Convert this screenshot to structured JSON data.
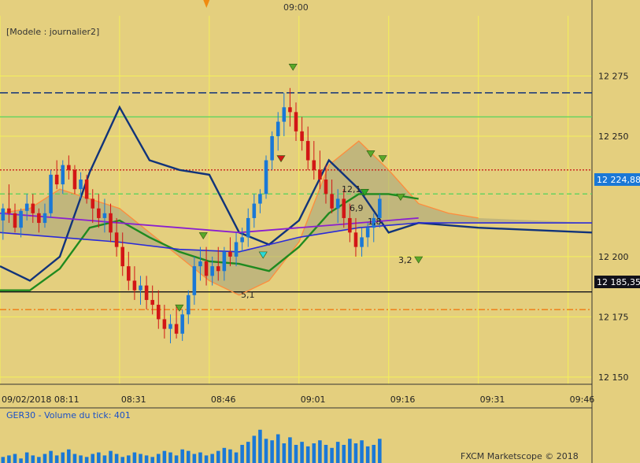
{
  "colors": {
    "background": "#e4cf7e",
    "grid": "#f4f05a",
    "candle_up": "#1a78d6",
    "candle_down": "#d21616",
    "tenkan": "#ff8c3c",
    "kijun": "#11337a",
    "chikou": "#1f8a1f",
    "span_a": "#2a2ad8",
    "ma": "#8a1fd0",
    "volume": "#1a78d6",
    "resistance": "#c81d1d",
    "support": "#f07a10",
    "cloud_fill": "#a4a27a",
    "cloud_fill_bear": "#e9a070"
  },
  "header": {
    "time_marker": "09:00"
  },
  "main_panel": {
    "title": "[Modele : journalier2]"
  },
  "volume_panel": {
    "title": "GER30 - Volume du tick: 401",
    "copyright": "FXCM Marketscope © 2018"
  },
  "price_labels": {
    "current": "12 224,88",
    "level": "12 185,35"
  },
  "annotations": [
    "12,1",
    "6,9",
    "1,8",
    "3,2",
    "5,1"
  ],
  "chart_data": {
    "type": "candlestick",
    "instrument": "GER30",
    "x_tick_labels": [
      "09/02/2018 08:11",
      "08:31",
      "08:46",
      "09:01",
      "09:16",
      "09:31",
      "09:46"
    ],
    "x_tick_minutes": [
      491,
      511,
      526,
      541,
      556,
      571,
      586
    ],
    "y_tick_labels": [
      "12 275",
      "12 250",
      "12 200",
      "12 175",
      "12 150"
    ],
    "y_tick_values": [
      12275,
      12250,
      12200,
      12175,
      12150
    ],
    "ylim": [
      12147,
      12300
    ],
    "xlim_minutes": [
      491,
      590
    ],
    "start_minute": 491,
    "candles": [
      [
        12215,
        12222,
        12207,
        12220
      ],
      [
        12220,
        12230,
        12214,
        12218
      ],
      [
        12218,
        12222,
        12210,
        12212
      ],
      [
        12212,
        12220,
        12208,
        12219
      ],
      [
        12219,
        12226,
        12215,
        12222
      ],
      [
        12222,
        12226,
        12214,
        12218
      ],
      [
        12218,
        12220,
        12210,
        12214
      ],
      [
        12214,
        12222,
        12212,
        12218
      ],
      [
        12218,
        12236,
        12216,
        12234
      ],
      [
        12234,
        12240,
        12228,
        12230
      ],
      [
        12230,
        12240,
        12226,
        12238
      ],
      [
        12238,
        12242,
        12232,
        12236
      ],
      [
        12236,
        12238,
        12226,
        12228
      ],
      [
        12228,
        12235,
        12224,
        12232
      ],
      [
        12232,
        12234,
        12222,
        12224
      ],
      [
        12224,
        12228,
        12214,
        12220
      ],
      [
        12220,
        12226,
        12212,
        12216
      ],
      [
        12216,
        12224,
        12210,
        12218
      ],
      [
        12218,
        12222,
        12206,
        12210
      ],
      [
        12210,
        12216,
        12200,
        12204
      ],
      [
        12204,
        12210,
        12192,
        12196
      ],
      [
        12196,
        12202,
        12186,
        12190
      ],
      [
        12190,
        12196,
        12182,
        12186
      ],
      [
        12186,
        12192,
        12180,
        12188
      ],
      [
        12188,
        12192,
        12178,
        12182
      ],
      [
        12182,
        12188,
        12176,
        12180
      ],
      [
        12180,
        12186,
        12170,
        12174
      ],
      [
        12174,
        12180,
        12166,
        12170
      ],
      [
        12170,
        12176,
        12164,
        12172
      ],
      [
        12172,
        12180,
        12166,
        12168
      ],
      [
        12168,
        12178,
        12165,
        12176
      ],
      [
        12176,
        12186,
        12172,
        12184
      ],
      [
        12184,
        12200,
        12180,
        12196
      ],
      [
        12196,
        12204,
        12190,
        12198
      ],
      [
        12198,
        12204,
        12188,
        12192
      ],
      [
        12192,
        12200,
        12188,
        12196
      ],
      [
        12196,
        12204,
        12190,
        12194
      ],
      [
        12194,
        12204,
        12190,
        12202
      ],
      [
        12202,
        12208,
        12196,
        12200
      ],
      [
        12200,
        12210,
        12196,
        12206
      ],
      [
        12206,
        12212,
        12202,
        12208
      ],
      [
        12208,
        12220,
        12204,
        12216
      ],
      [
        12216,
        12226,
        12212,
        12222
      ],
      [
        12222,
        12228,
        12218,
        12226
      ],
      [
        12226,
        12242,
        12224,
        12240
      ],
      [
        12240,
        12252,
        12236,
        12250
      ],
      [
        12250,
        12260,
        12244,
        12256
      ],
      [
        12256,
        12268,
        12250,
        12262
      ],
      [
        12262,
        12270,
        12254,
        12260
      ],
      [
        12260,
        12264,
        12248,
        12252
      ],
      [
        12252,
        12258,
        12244,
        12248
      ],
      [
        12248,
        12254,
        12236,
        12240
      ],
      [
        12240,
        12248,
        12232,
        12236
      ],
      [
        12236,
        12244,
        12228,
        12232
      ],
      [
        12232,
        12238,
        12222,
        12226
      ],
      [
        12226,
        12232,
        12218,
        12220
      ],
      [
        12220,
        12228,
        12214,
        12224
      ],
      [
        12224,
        12228,
        12212,
        12216
      ],
      [
        12216,
        12222,
        12206,
        12210
      ],
      [
        12210,
        12216,
        12200,
        12204
      ],
      [
        12204,
        12212,
        12200,
        12208
      ],
      [
        12208,
        12214,
        12204,
        12212
      ],
      [
        12212,
        12218,
        12206,
        12216
      ],
      [
        12216,
        12226,
        12212,
        12224
      ]
    ],
    "series": [
      {
        "values": [
          [
            491,
            12218
          ],
          [
            496,
            12220
          ],
          [
            501,
            12228
          ],
          [
            506,
            12224
          ],
          [
            511,
            12220
          ],
          [
            516,
            12210
          ],
          [
            521,
            12200
          ],
          [
            526,
            12190
          ],
          [
            531,
            12184
          ],
          [
            536,
            12190
          ],
          [
            541,
            12206
          ],
          [
            546,
            12238
          ],
          [
            551,
            12248
          ],
          [
            556,
            12236
          ],
          [
            561,
            12222
          ],
          [
            566,
            12218
          ],
          [
            571,
            12216
          ]
        ]
      },
      {
        "values": [
          [
            491,
            12196
          ],
          [
            496,
            12190
          ],
          [
            501,
            12200
          ],
          [
            506,
            12235
          ],
          [
            511,
            12262
          ],
          [
            516,
            12240
          ],
          [
            521,
            12236
          ],
          [
            526,
            12234
          ],
          [
            531,
            12210
          ],
          [
            536,
            12205
          ],
          [
            541,
            12215
          ],
          [
            546,
            12240
          ],
          [
            551,
            12228
          ],
          [
            556,
            12210
          ],
          [
            561,
            12214
          ],
          [
            571,
            12212
          ],
          [
            590,
            12210
          ]
        ]
      },
      {
        "values": [
          [
            491,
            12186
          ],
          [
            496,
            12186
          ],
          [
            501,
            12195
          ],
          [
            506,
            12212
          ],
          [
            511,
            12215
          ],
          [
            516,
            12208
          ],
          [
            521,
            12202
          ],
          [
            526,
            12198
          ],
          [
            531,
            12197
          ],
          [
            536,
            12194
          ],
          [
            541,
            12204
          ],
          [
            546,
            12218
          ],
          [
            551,
            12226
          ],
          [
            556,
            12226
          ],
          [
            561,
            12224
          ]
        ]
      },
      {
        "values": [
          [
            491,
            12210
          ],
          [
            501,
            12208
          ],
          [
            511,
            12206
          ],
          [
            521,
            12203
          ],
          [
            531,
            12202
          ],
          [
            541,
            12208
          ],
          [
            551,
            12212
          ],
          [
            561,
            12214
          ],
          [
            571,
            12214
          ],
          [
            590,
            12214
          ]
        ]
      },
      {
        "values": [
          [
            491,
            12218
          ],
          [
            501,
            12216
          ],
          [
            511,
            12214
          ],
          [
            521,
            12212
          ],
          [
            531,
            12210
          ],
          [
            541,
            12212
          ],
          [
            551,
            12214
          ],
          [
            561,
            12216
          ]
        ]
      }
    ],
    "horizontal_levels": [
      12268,
      12258,
      12236,
      12226,
      12185.35,
      12178
    ],
    "volume": [
      4,
      5,
      6,
      3,
      7,
      5,
      4,
      6,
      8,
      5,
      7,
      9,
      6,
      5,
      4,
      6,
      7,
      5,
      8,
      6,
      4,
      5,
      7,
      6,
      5,
      4,
      6,
      8,
      7,
      5,
      9,
      8,
      6,
      7,
      5,
      6,
      8,
      10,
      9,
      7,
      12,
      14,
      18,
      22,
      16,
      15,
      19,
      13,
      17,
      12,
      14,
      11,
      13,
      15,
      12,
      10,
      14,
      12,
      16,
      13,
      15,
      11,
      12,
      16
    ],
    "volume_ylim": [
      0,
      25
    ]
  }
}
